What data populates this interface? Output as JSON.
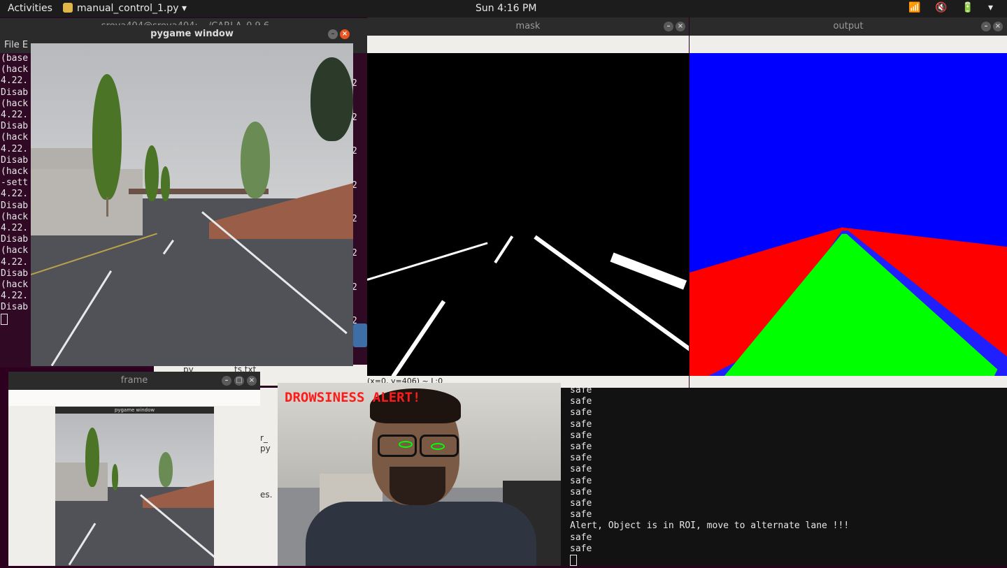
{
  "topbar": {
    "activities": "Activities",
    "app_name": "manual_control_1.py",
    "clock": "Sun  4:16 PM",
    "tray": "📶 🔇 🔋 ▾"
  },
  "terminal": {
    "title": "sreya404@sreya404: ~/CARLA_0.9.6",
    "menu": "File  E",
    "lines": [
      "(base",
      "(hack",
      "4.22.",
      "Disab",
      "(hack",
      "4.22.",
      "Disab",
      "(hack",
      "4.22.",
      "Disab",
      "(hack",
      "-sett",
      "4.22.",
      "Disab",
      "(hack",
      "4.22.",
      "Disab",
      "(hack",
      "4.22.",
      "Disab",
      "(hack",
      "4.22.",
      "Disab"
    ],
    "right_digits": [
      "2",
      "2",
      "2",
      "2",
      "2",
      "2",
      "2",
      "2"
    ]
  },
  "pygame": {
    "title": "pygame window",
    "min": "–",
    "close": "×"
  },
  "mask": {
    "title": "mask",
    "status": "(x=0, y=406) ~ L:0"
  },
  "output": {
    "title": "output"
  },
  "frame": {
    "title": "frame",
    "inner_title": "pygame window"
  },
  "filemanager": {
    "items": [
      "py",
      "ts.txt"
    ],
    "side_texts": [
      "r_",
      "py",
      "es."
    ]
  },
  "camera": {
    "alert": "DROWSINESS ALERT!"
  },
  "terminal2": {
    "lines": [
      "safe",
      "safe",
      "safe",
      "safe",
      "safe",
      "safe",
      "safe",
      "safe",
      "safe",
      "safe",
      "safe",
      "safe",
      "Alert, Object is in ROI, move to alternate lane !!!",
      "safe",
      "safe"
    ]
  },
  "colors": {
    "alert": "#ff1a1a",
    "mask_bg": "#000000",
    "output_road": "#00ff00",
    "output_side": "#ff0000",
    "output_sky": "#0000ff"
  }
}
